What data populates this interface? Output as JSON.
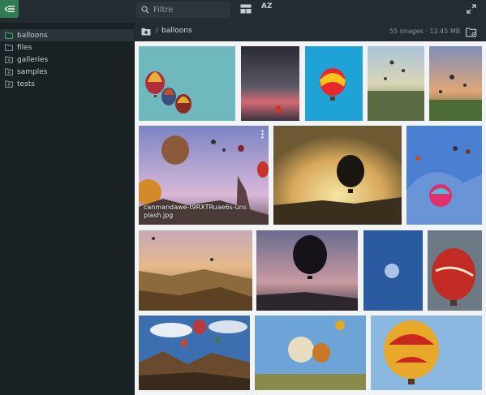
{
  "toolbar": {
    "search_placeholder": "Filtre",
    "sort_label": "AZ"
  },
  "sidebar": {
    "items": [
      {
        "label": "balloons",
        "active": true
      },
      {
        "label": "files",
        "active": false
      },
      {
        "label": "galleries",
        "active": false
      },
      {
        "label": "samples",
        "active": false
      },
      {
        "label": "tests",
        "active": false
      }
    ]
  },
  "breadcrumb": {
    "separator": "/",
    "current": "balloons",
    "image_count": "55 images",
    "size": "12.45 MB"
  },
  "gallery": {
    "hover_caption": "canmandawe-t9RXTRuae6s-unsplash.jpg"
  },
  "colors": {
    "accent": "#2f7d4f",
    "sidebar_bg": "#1a2125",
    "topbar_bg": "#232c30",
    "gallery_bg": "#f1f3f4"
  }
}
